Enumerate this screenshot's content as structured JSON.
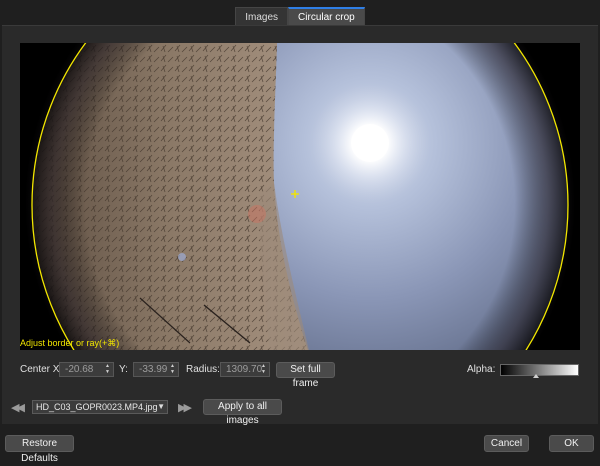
{
  "tabs": [
    {
      "label": "Images",
      "active": false
    },
    {
      "label": "Circular crop",
      "active": true
    }
  ],
  "preview": {
    "hint": "Adjust border or ray(+⌘)"
  },
  "controls": {
    "center_x_label": "Center X:",
    "center_x_value": "-20.68",
    "y_label": "Y:",
    "y_value": "-33.99",
    "radius_label": "Radius:",
    "radius_value": "1309.70",
    "set_full_frame": "Set full frame",
    "alpha_label": "Alpha:",
    "alpha_level": 0.45
  },
  "image_nav": {
    "prev_icon": "rewind-icon",
    "next_icon": "fast-forward-icon",
    "selected_file": "HD_C03_GOPR0023.MP4.jpg",
    "apply_all": "Apply to all images"
  },
  "footer": {
    "restore_defaults": "Restore Defaults",
    "cancel": "Cancel",
    "ok": "OK"
  },
  "colors": {
    "accent": "#2f7fe6",
    "crop_circle": "#f2e600",
    "background": "#1f1f1f"
  }
}
